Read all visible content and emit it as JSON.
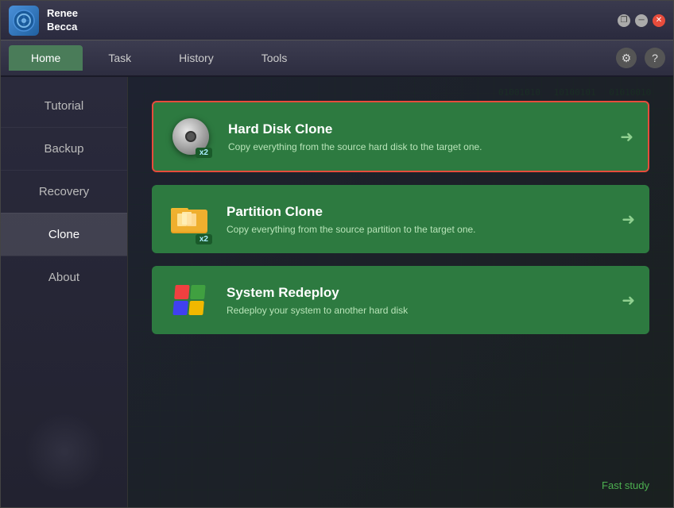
{
  "app": {
    "name_line1": "Renee",
    "name_line2": "Becca"
  },
  "titlebar": {
    "restore_label": "❐",
    "minimize_label": "─",
    "close_label": "✕"
  },
  "nav": {
    "tabs": [
      {
        "id": "home",
        "label": "Home",
        "active": true
      },
      {
        "id": "task",
        "label": "Task",
        "active": false
      },
      {
        "id": "history",
        "label": "History",
        "active": false
      },
      {
        "id": "tools",
        "label": "Tools",
        "active": false
      }
    ],
    "gear_icon": "⚙",
    "help_icon": "?"
  },
  "sidebar": {
    "items": [
      {
        "id": "tutorial",
        "label": "Tutorial"
      },
      {
        "id": "backup",
        "label": "Backup"
      },
      {
        "id": "recovery",
        "label": "Recovery"
      },
      {
        "id": "clone",
        "label": "Clone",
        "active": true
      },
      {
        "id": "about",
        "label": "About"
      }
    ]
  },
  "cards": [
    {
      "id": "hard-disk-clone",
      "title": "Hard Disk Clone",
      "desc": "Copy everything from the source hard disk to the target one.",
      "badge": "x2",
      "selected": true,
      "icon_type": "disk"
    },
    {
      "id": "partition-clone",
      "title": "Partition Clone",
      "desc": "Copy everything from the source partition to the target one.",
      "badge": "x2",
      "selected": false,
      "icon_type": "folder"
    },
    {
      "id": "system-redeploy",
      "title": "System Redeploy",
      "desc": "Redeploy your system to another hard disk",
      "badge": null,
      "selected": false,
      "icon_type": "windows"
    }
  ],
  "fast_study_label": "Fast study"
}
